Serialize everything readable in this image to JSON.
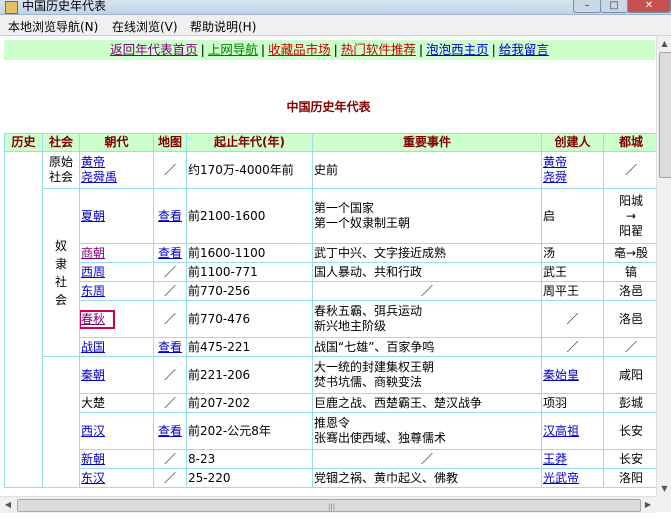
{
  "window": {
    "title": "中国历史年代表"
  },
  "menu": [
    "本地浏览导航(N)",
    "在线浏览(V)",
    "帮助说明(H)"
  ],
  "nav": [
    {
      "label": "返回年代表首页",
      "color": "#800080"
    },
    {
      "label": "上网导航",
      "color": "#008000"
    },
    {
      "label": "收藏品市场",
      "color": "#cc0000"
    },
    {
      "label": "热门软件推荐",
      "color": "#cc0000"
    },
    {
      "label": "泡泡西主页",
      "color": "#0000cc"
    },
    {
      "label": "给我留言",
      "color": "#0000cc"
    }
  ],
  "page_title": "中国历史年代表",
  "table": {
    "headers": [
      "历史",
      "社会",
      "朝代",
      "地图",
      "起止年代(年)",
      "重要事件",
      "创建人",
      "都城"
    ],
    "society": {
      "primitive": "原始\n社会",
      "slave": "奴\n隶\n社\n会"
    },
    "rows": [
      {
        "dyn": "黄帝\n尧舜禹",
        "map": "／",
        "years": "约170万-4000年前",
        "events": "史前",
        "founder": "黄帝\n尧舜",
        "capital": "／"
      },
      {
        "dyn": "夏朝",
        "map": "查看",
        "years": "前2100-1600",
        "events": "第一个国家\n第一个奴隶制王朝",
        "founder": "启",
        "capital": "阳城\n→\n阳翟"
      },
      {
        "dyn": "商朝",
        "map": "查看",
        "years": "前1600-1100",
        "events": "武丁中兴、文字接近成熟",
        "founder": "汤",
        "capital": "亳→殷"
      },
      {
        "dyn": "西周",
        "map": "／",
        "years": "前1100-771",
        "events": "国人暴动、共和行政",
        "founder": "武王",
        "capital": "镐"
      },
      {
        "dyn": "东周",
        "map": "／",
        "years": "前770-256",
        "events": "／",
        "founder": "周平王",
        "capital": "洛邑"
      },
      {
        "dyn": "春秋",
        "map": "／",
        "years": "前770-476",
        "events": "春秋五霸、弭兵运动\n新兴地主阶级",
        "founder": "／",
        "capital": "洛邑"
      },
      {
        "dyn": "战国",
        "map": "查看",
        "years": "前475-221",
        "events": "战国“七雄”、百家争鸣",
        "founder": "／",
        "capital": "／"
      },
      {
        "dyn": "秦朝",
        "map": "／",
        "years": "前221-206",
        "events": "大一统的封建集权王朝\n焚书坑儒、商鞅变法",
        "founder": "秦始皇",
        "capital": "咸阳"
      },
      {
        "dyn": "大楚",
        "map": "／",
        "years": "前207-202",
        "events": "巨鹿之战、西楚霸王、楚汉战争",
        "founder": "项羽",
        "capital": "彭城"
      },
      {
        "dyn": "西汉",
        "map": "查看",
        "years": "前202-公元8年",
        "events": "推恩令\n张骞出使西域、独尊儒术",
        "founder": "汉高祖",
        "capital": "长安"
      },
      {
        "dyn": "新朝",
        "map": "／",
        "years": "8-23",
        "events": "／",
        "founder": "王莽",
        "capital": "长安"
      },
      {
        "dyn": "东汉",
        "map": "／",
        "years": "25-220",
        "events": "党锢之祸、黄巾起义、佛教",
        "founder": "光武帝",
        "capital": "洛阳"
      }
    ]
  }
}
